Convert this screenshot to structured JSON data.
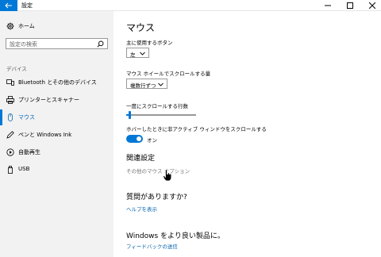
{
  "window": {
    "title": "設定"
  },
  "sidebar": {
    "home_label": "ホーム",
    "search_placeholder": "設定の検索",
    "section_label": "デバイス",
    "items": [
      {
        "label": "Bluetooth とその他のデバイス",
        "icon": "bluetooth-devices-icon",
        "active": false
      },
      {
        "label": "プリンターとスキャナー",
        "icon": "printer-icon",
        "active": false
      },
      {
        "label": "マウス",
        "icon": "mouse-icon",
        "active": true
      },
      {
        "label": "ペンと Windows Ink",
        "icon": "pen-icon",
        "active": false
      },
      {
        "label": "自動再生",
        "icon": "autoplay-icon",
        "active": false
      },
      {
        "label": "USB",
        "icon": "usb-icon",
        "active": false
      }
    ]
  },
  "main": {
    "title": "マウス",
    "primary_button": {
      "label": "主に使用するボタン",
      "value": "左"
    },
    "wheel_scroll": {
      "label": "マウス ホイールでスクロールする量",
      "value": "複数行ずつ"
    },
    "lines_to_scroll": {
      "label": "一度にスクロールする行数",
      "value_fraction": 0.03
    },
    "hover_scroll": {
      "label": "ホバーしたときに非アクティブ ウィンドウをスクロールする",
      "state": "オン"
    },
    "related": {
      "heading": "関連設定",
      "link": "その他のマウス オプション"
    },
    "help": {
      "heading": "質問がありますか?",
      "link": "ヘルプを表示"
    },
    "feedback": {
      "heading": "Windows をより良い製品に。",
      "link": "フィードバックの送信"
    }
  },
  "colors": {
    "accent": "#0078d7",
    "link": "#0063b1",
    "sidebar_bg": "#f2f2f2"
  }
}
